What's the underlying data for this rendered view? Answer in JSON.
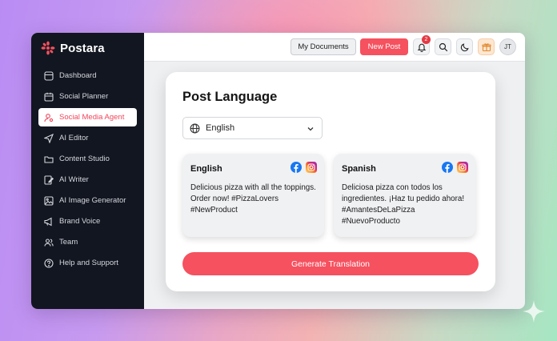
{
  "app": {
    "brand": "Postara"
  },
  "sidebar": {
    "items": [
      {
        "label": "Dashboard",
        "icon": "dashboard-icon"
      },
      {
        "label": "Social Planner",
        "icon": "calendar-icon"
      },
      {
        "label": "Social Media Agent",
        "icon": "agent-icon",
        "active": true
      },
      {
        "label": "AI Editor",
        "icon": "send-icon"
      },
      {
        "label": "Content Studio",
        "icon": "folder-icon"
      },
      {
        "label": "AI Writer",
        "icon": "pencil-icon"
      },
      {
        "label": "AI Image Generator",
        "icon": "image-icon"
      },
      {
        "label": "Brand Voice",
        "icon": "megaphone-icon"
      },
      {
        "label": "Team",
        "icon": "team-icon"
      },
      {
        "label": "Help and Support",
        "icon": "help-icon"
      }
    ]
  },
  "topbar": {
    "my_documents": "My Documents",
    "new_post": "New Post",
    "notification_count": "2",
    "avatar_initials": "JT"
  },
  "main": {
    "title": "Post Language",
    "language_select": {
      "value": "English"
    },
    "translations": [
      {
        "language": "English",
        "text": "Delicious pizza with all the toppings. Order now! #PizzaLovers #NewProduct"
      },
      {
        "language": "Spanish",
        "text": "Deliciosa pizza con todos los ingredientes. ¡Haz tu pedido ahora! #AmantesDeLaPizza #NuevoProducto"
      }
    ],
    "generate_button": "Generate Translation"
  },
  "colors": {
    "accent": "#f5515f",
    "sidebar_bg": "#121620",
    "facebook": "#1877f2",
    "instagram": "#d6249f"
  }
}
